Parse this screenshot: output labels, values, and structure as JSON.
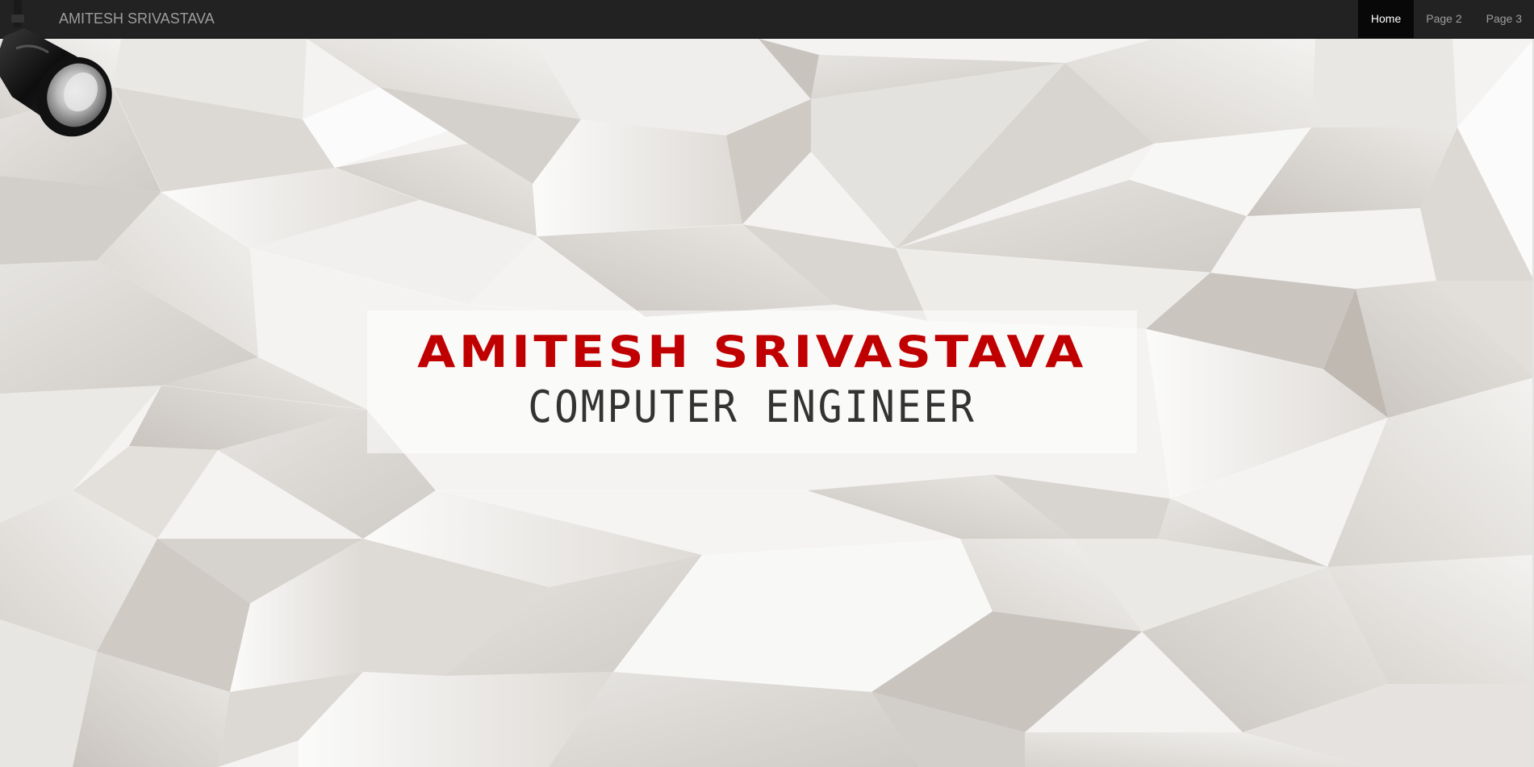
{
  "navbar": {
    "brand": "AMITESH SRIVASTAVA",
    "items": [
      {
        "label": "Home",
        "active": true
      },
      {
        "label": "Page 2",
        "active": false
      },
      {
        "label": "Page 3",
        "active": false
      }
    ]
  },
  "hero": {
    "name": "AMITESH SRIVASTAVA",
    "role": "COMPUTER ENGINEER"
  },
  "colors": {
    "navbar_bg": "#222222",
    "active_nav_bg": "#080808",
    "name_red": "#c00000",
    "role_gray": "#333333"
  },
  "icons": [
    "spotlight-icon"
  ]
}
